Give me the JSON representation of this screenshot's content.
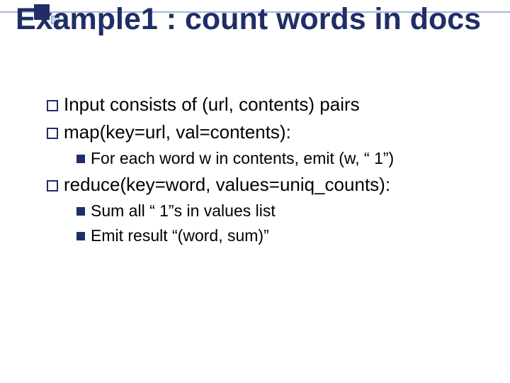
{
  "title": "Example1 : count words in docs",
  "bullets": {
    "b1": "Input consists of (url, contents) pairs",
    "b2": "map(key=url, val=contents):",
    "b2a": "For each word w in contents, emit (w, “ 1”)",
    "b3": "reduce(key=word, values=uniq_counts):",
    "b3a": "Sum all “ 1”s in values list",
    "b3b": "Emit result “(word, sum)”"
  }
}
